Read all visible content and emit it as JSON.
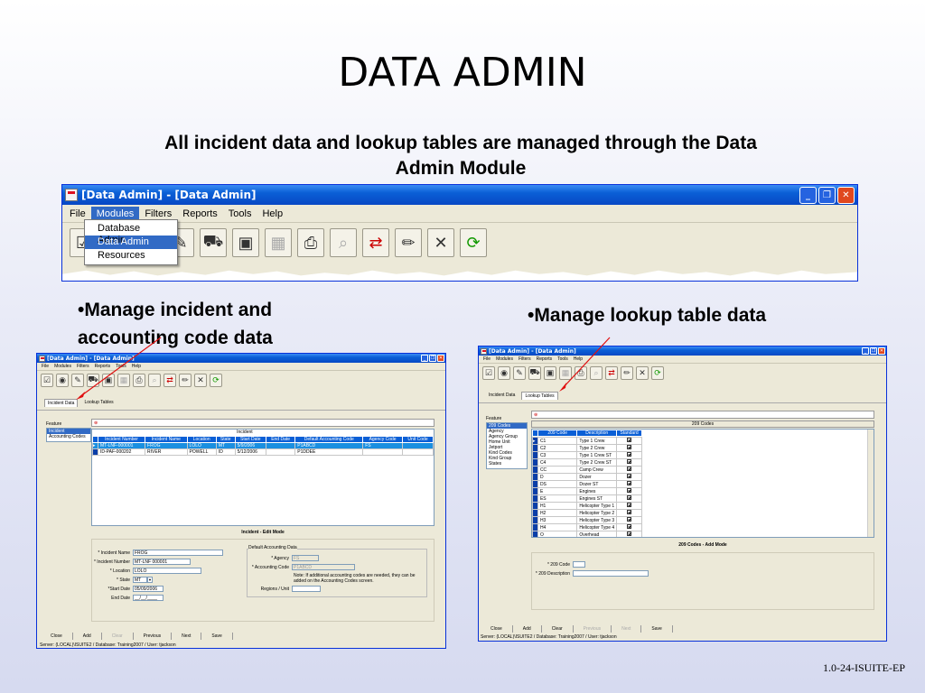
{
  "slide": {
    "title": "DATA ADMIN",
    "subtitle": "All incident data and lookup tables are managed through the Data Admin Module",
    "bullet_left": "•Manage incident and accounting code data",
    "bullet_right": "•Manage lookup table data",
    "footer": "1.0-24-ISUITE-EP"
  },
  "main_window": {
    "title": "[Data Admin] - [Data Admin]",
    "menu": [
      "File",
      "Modules",
      "Filters",
      "Reports",
      "Tools",
      "Help"
    ],
    "modules_menu": [
      "Database Admin",
      "Data Admin",
      "Resources"
    ]
  },
  "left_window": {
    "title": "[Data Admin] - [Data Admin]",
    "menu": [
      "File",
      "Modules",
      "Filters",
      "Reports",
      "Tools",
      "Help"
    ],
    "tabs": [
      "Incident Data",
      "Lookup Tables"
    ],
    "feature_label": "Feature",
    "features": [
      "Incident",
      "Accounting Codes"
    ],
    "group_header": "Incident",
    "columns": [
      "Incident Number",
      "Incident Name",
      "Location",
      "State",
      "Start Date",
      "End Date",
      "Default Accounting Code",
      "Agency Code",
      "Unit Code"
    ],
    "rows": [
      [
        "MT-LNF-000001",
        "FROG",
        "LOLO",
        "MT",
        "5/9/2006",
        "",
        "P1ABCD",
        "FS",
        ""
      ],
      [
        "ID-PAF-000202",
        "RIVER",
        "POWELL",
        "ID",
        "5/12/2006",
        "",
        "P1DDEE",
        "",
        ""
      ]
    ],
    "mode_title": "Incident - Edit Mode",
    "form": {
      "incident_name_label": "* Incident Name",
      "incident_name": "FROG",
      "incident_number_label": "* Incident Number",
      "incident_number": "MT-LNF 000001",
      "location_label": "* Location",
      "location": "LOLO",
      "state_label": "* State",
      "state": "MT",
      "start_date_label": "*Start Date",
      "start_date": "05/09/2006",
      "end_date_label": "End Date",
      "end_date": "__/__/____",
      "group_label": "Default Accounting Data",
      "agency_label": "* Agency",
      "agency": "FS",
      "accounting_code_label": "* Accounting Code",
      "accounting_code": "P1ABCD",
      "note": "Note:  If additional accounting codes are needed, they can be added on the Accounting Codes screen.",
      "regions_label": "Regions / Unit"
    },
    "buttons": [
      "Close",
      "Add",
      "Clear",
      "Previous",
      "Next",
      "Save"
    ],
    "status": "Server: (LOCAL)\\ISUITE2  /  Database: Training2007  /  User: tjackson"
  },
  "right_window": {
    "title": "[Data Admin] - [Data Admin]",
    "menu": [
      "File",
      "Modules",
      "Filters",
      "Reports",
      "Tools",
      "Help"
    ],
    "tabs": [
      "Incident Data",
      "Lookup Tables"
    ],
    "feature_label": "Feature",
    "features": [
      "209 Codes",
      "Agency",
      "Agency Group",
      "Home Unit",
      "Jetport",
      "Kind Codes",
      "Kind Group",
      "States"
    ],
    "grid_title": "209 Codes",
    "columns": [
      "209 Code",
      "Description",
      "Standard"
    ],
    "rows": [
      [
        "C1",
        "Type 1 Crew"
      ],
      [
        "C2",
        "Type 2 Crew"
      ],
      [
        "C3",
        "Type 1 Crew ST"
      ],
      [
        "C4",
        "Type 2 Crew ST"
      ],
      [
        "CC",
        "Camp Crew"
      ],
      [
        "D",
        "Dozer"
      ],
      [
        "DS",
        "Dozer ST"
      ],
      [
        "E",
        "Engines"
      ],
      [
        "ES",
        "Engines ST"
      ],
      [
        "H1",
        "Helicopter Type 1"
      ],
      [
        "H2",
        "Helicopter Type 2"
      ],
      [
        "H3",
        "Helicopter Type 3"
      ],
      [
        "H4",
        "Helicopter Type 4"
      ],
      [
        "O",
        "Overhead"
      ]
    ],
    "mode_title": "209 Codes - Add Mode",
    "form": {
      "code_label": "* 209 Code",
      "description_label": "* 209 Description"
    },
    "buttons": [
      "Close",
      "Add",
      "Clear",
      "Previous",
      "Next",
      "Save"
    ],
    "status": "Server: (LOCAL)\\ISUITE2  /  Database: Training2007  /  User: tjackson"
  }
}
